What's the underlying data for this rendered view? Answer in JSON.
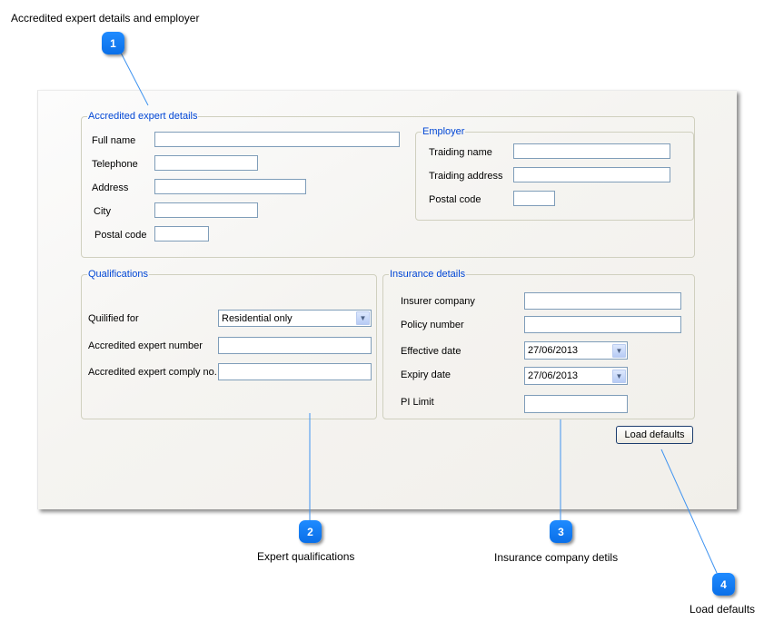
{
  "callouts": [
    {
      "number": "1",
      "caption": "Accredited expert details and employer"
    },
    {
      "number": "2",
      "caption": "Expert qualifications"
    },
    {
      "number": "3",
      "caption": "Insurance company detils"
    },
    {
      "number": "4",
      "caption": "Load defaults"
    }
  ],
  "form": {
    "expert_details": {
      "legend": "Accredited expert details",
      "fields": [
        {
          "label": "Full name",
          "value": ""
        },
        {
          "label": "Telephone",
          "value": ""
        },
        {
          "label": "Address",
          "value": ""
        },
        {
          "label": "City",
          "value": ""
        },
        {
          "label": "Postal code",
          "value": ""
        }
      ]
    },
    "employer": {
      "legend": "Employer",
      "fields": [
        {
          "label": "Traiding name",
          "value": ""
        },
        {
          "label": "Traiding address",
          "value": ""
        },
        {
          "label": "Postal code",
          "value": ""
        }
      ]
    },
    "qualifications": {
      "legend": "Qualifications",
      "qualified_for": {
        "label": "Quilified for",
        "selected": "Residential only"
      },
      "expert_number": {
        "label": "Accredited expert number",
        "value": ""
      },
      "comply_no": {
        "label": "Accredited expert comply no.",
        "value": ""
      }
    },
    "insurance": {
      "legend": "Insurance details",
      "insurer_company": {
        "label": "Insurer company",
        "value": ""
      },
      "policy_number": {
        "label": "Policy number",
        "value": ""
      },
      "effective_date": {
        "label": "Effective date",
        "value": "27/06/2013"
      },
      "expiry_date": {
        "label": "Expiry date",
        "value": "27/06/2013"
      },
      "pi_limit": {
        "label": "PI Limit",
        "value": ""
      }
    },
    "load_defaults_label": "Load defaults"
  },
  "icons": {
    "dropdown": "chevron-down"
  },
  "colors": {
    "callout_badge": "#1f8bff",
    "callout_line": "#3f93f0",
    "legend_text": "#0046d5",
    "input_border": "#7f9db9"
  }
}
